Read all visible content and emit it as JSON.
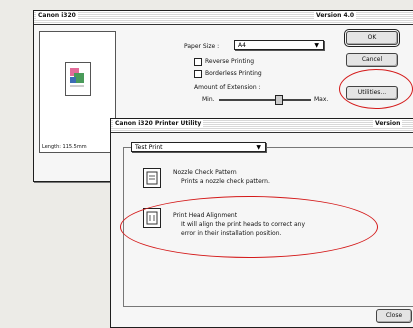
{
  "back_window": {
    "title": "Canon i320",
    "version": "Version 4.0",
    "preview_caption": "Length: 115.5mm",
    "paper_size_label": "Paper Size :",
    "paper_size_value": "A4",
    "option_1": "Reverse Printing",
    "option_2": "Borderless Printing",
    "extension_label": "Amount of Extension :",
    "slider_min": "Min.",
    "slider_max": "Max.",
    "ok_button": "OK",
    "cancel_button": "Cancel",
    "utilities_button": "Utilities..."
  },
  "front_window": {
    "title": "Canon i320 Printer Utility",
    "version": "Version",
    "dropdown_value": "Test Print",
    "nozzle_title": "Nozzle Check Pattern",
    "nozzle_desc": "Prints a nozzle check pattern.",
    "align_title": "Print Head Alignment",
    "align_desc_1": "It will align the print heads to correct any",
    "align_desc_2": "error in their installation position.",
    "close_button": "Close"
  }
}
